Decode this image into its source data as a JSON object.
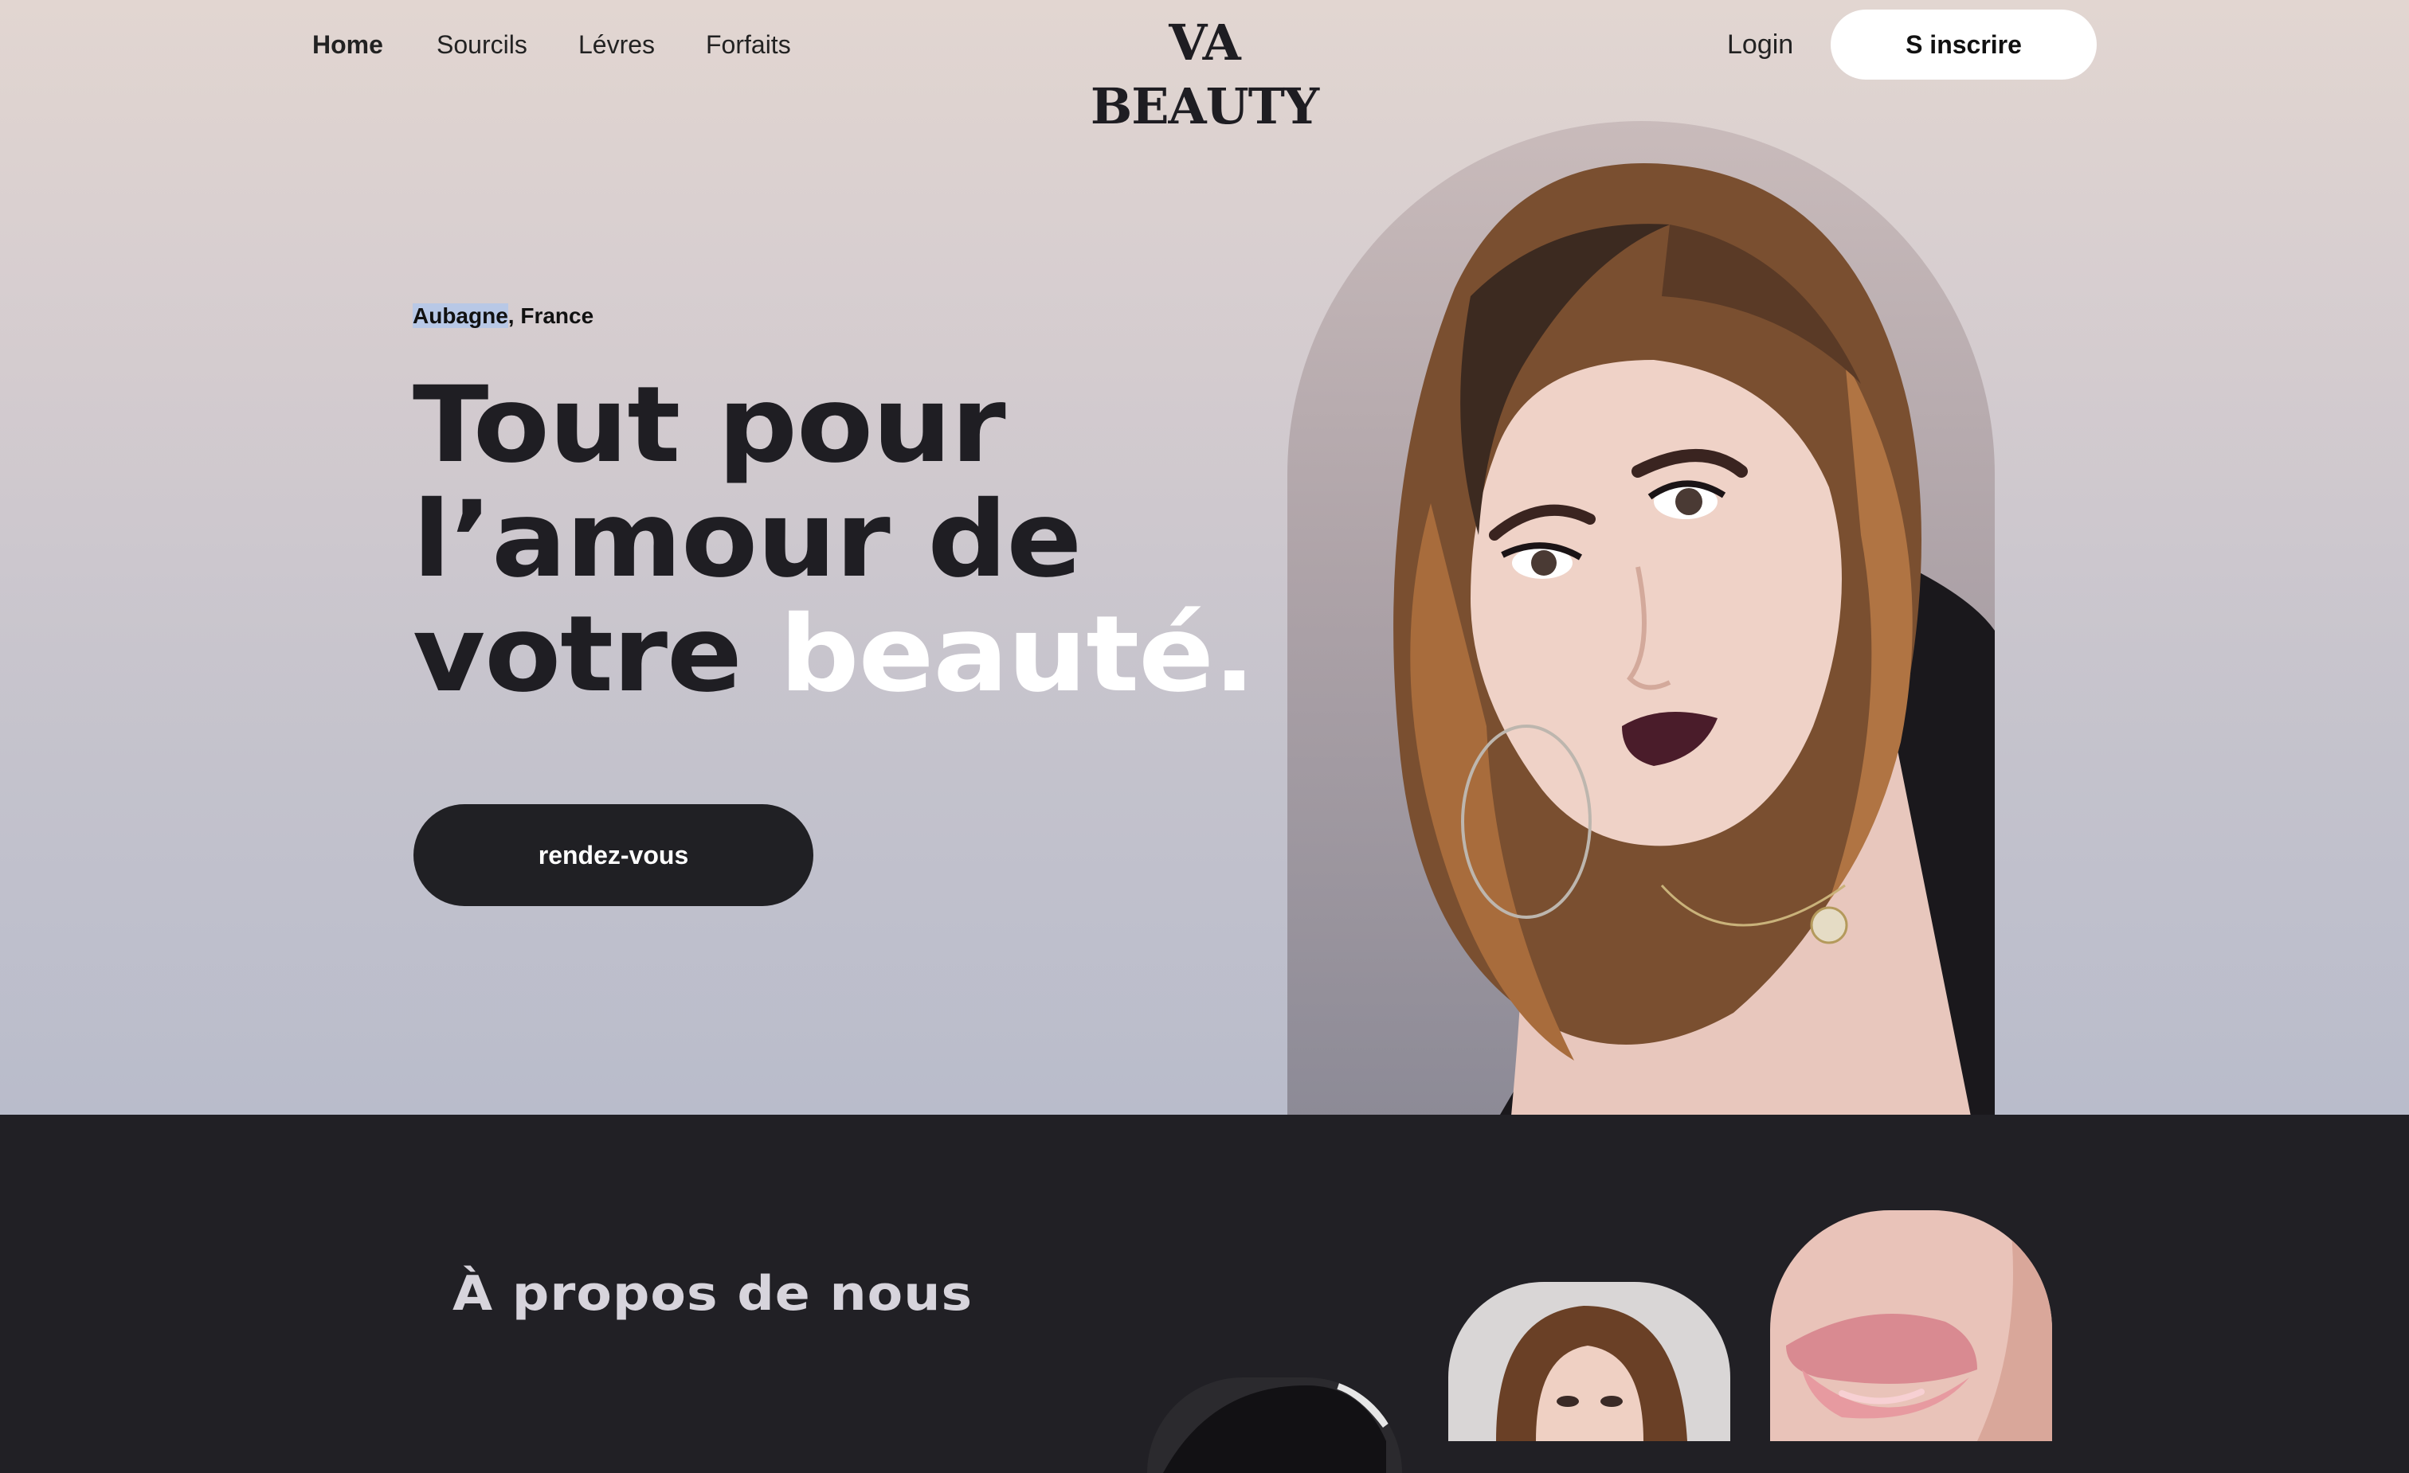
{
  "nav": {
    "links": [
      "Home",
      "Sourcils",
      "Lévres",
      "Forfaits"
    ],
    "brand": "VA BEAUTY",
    "login": "Login",
    "signup": "S inscrire"
  },
  "hero": {
    "location_city": "Aubagne",
    "location_rest": ", France",
    "headline_line1": "Tout pour",
    "headline_line2": "l’amour de",
    "headline_line3_start": "votre ",
    "headline_highlight": "beauté.",
    "cta": "rendez-vous"
  },
  "about": {
    "title": "À propos de nous"
  },
  "colors": {
    "dark": "#212025",
    "highlight_text": "#ffffff",
    "button_light": "#ffffff"
  }
}
